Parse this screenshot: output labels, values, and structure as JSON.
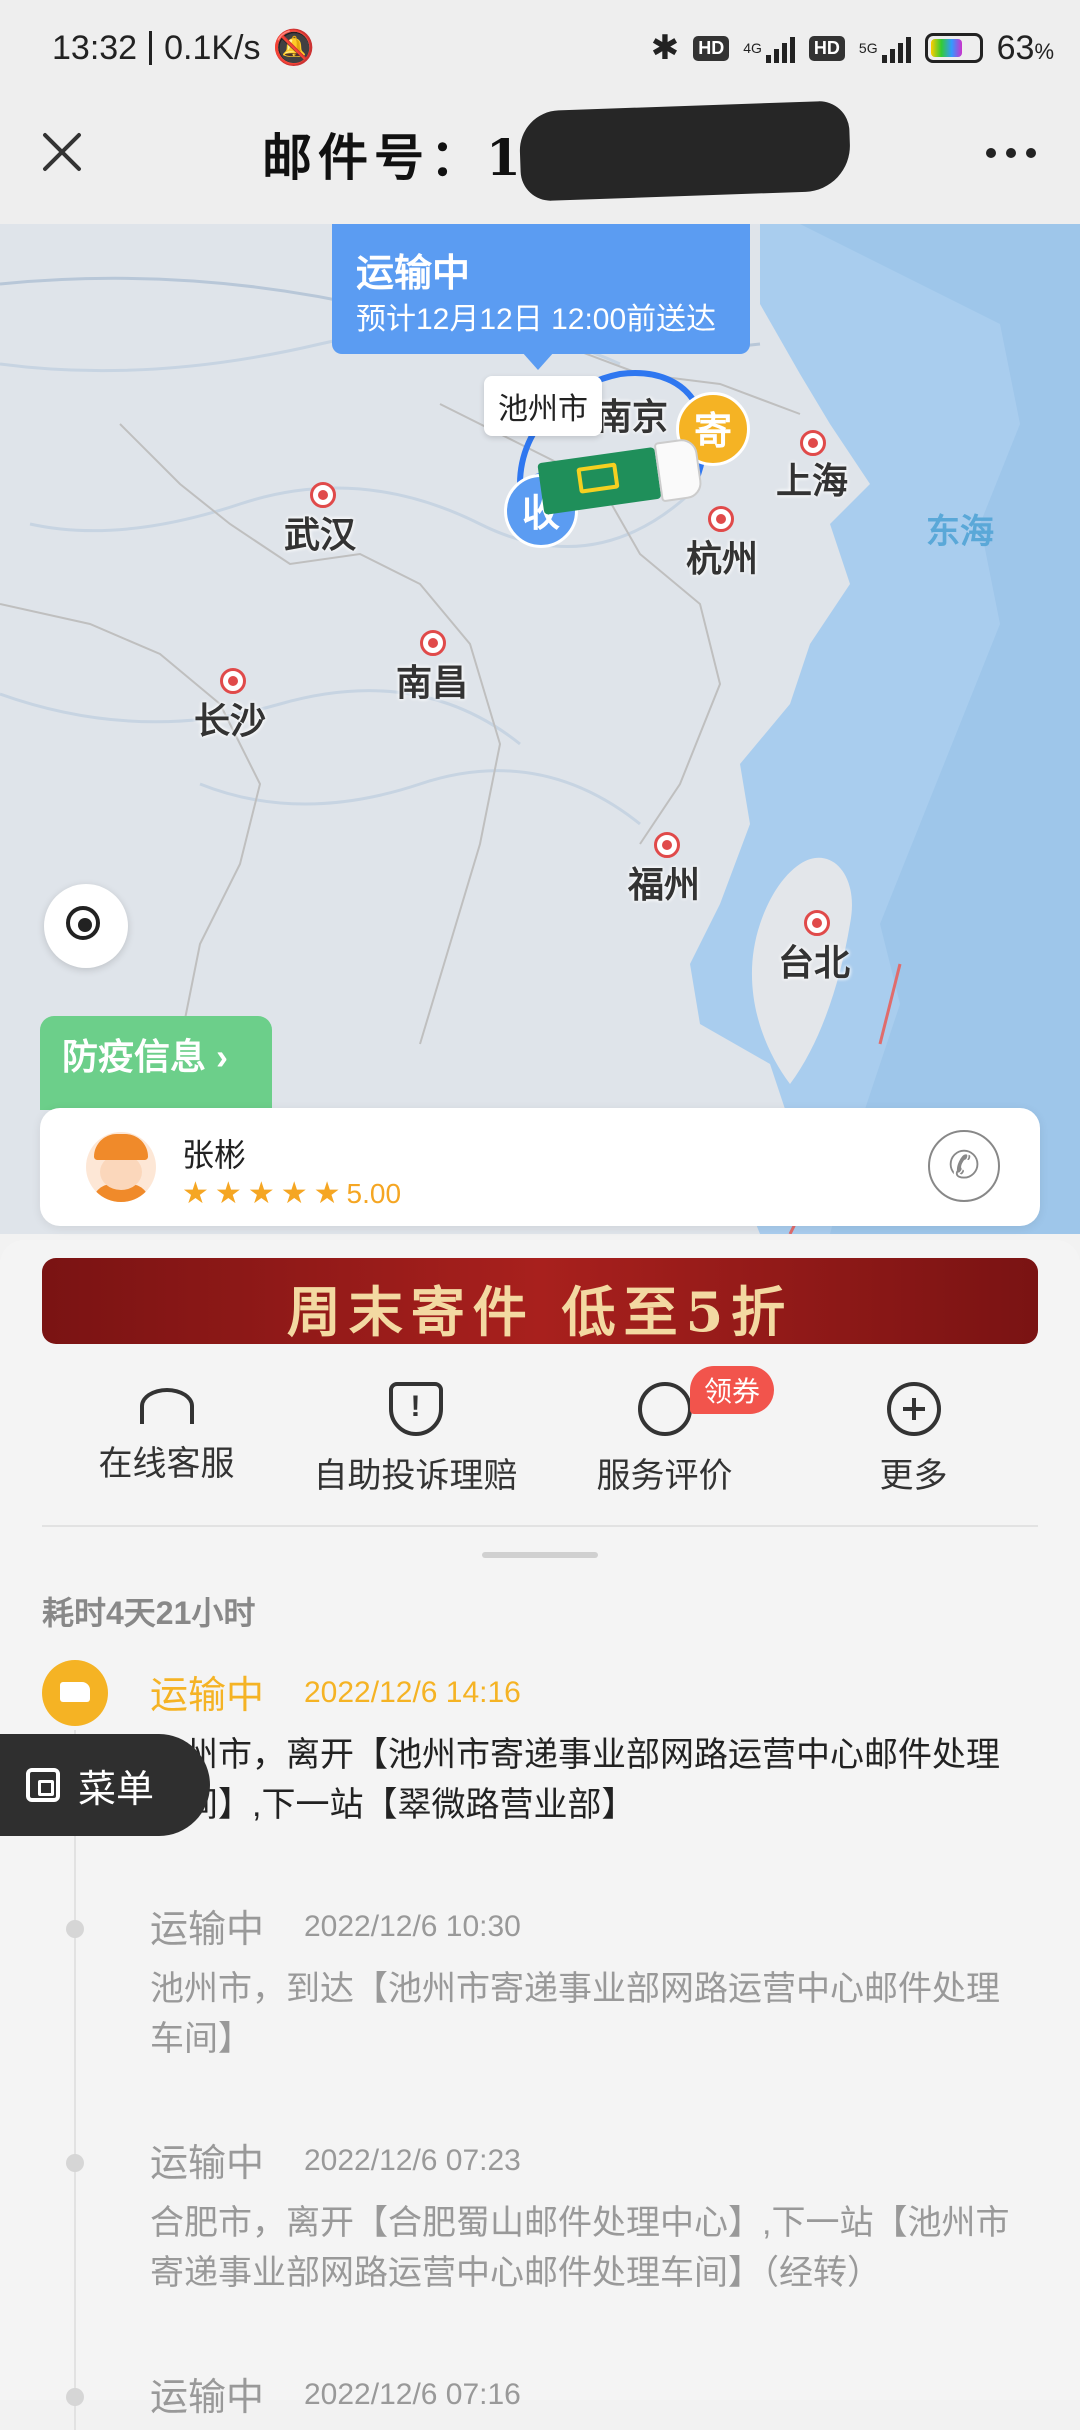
{
  "status_bar": {
    "time": "13:32",
    "net_speed": "0.1K/s",
    "battery": "63",
    "battery_unit": "%",
    "hd1": "HD",
    "hd2": "HD",
    "net1": "4G",
    "net2": "5G"
  },
  "header": {
    "title": "邮件号：12"
  },
  "map": {
    "status": "运输中",
    "eta": "预计12月12日 12:00前送达",
    "current_location": "池州市",
    "send_badge": "寄",
    "receive_badge": "收",
    "sea": "东海",
    "cities": [
      "南京",
      "上海",
      "杭州",
      "武汉",
      "南昌",
      "长沙",
      "福州",
      "台北"
    ]
  },
  "epidemic_button": "防疫信息 ›",
  "courier": {
    "name": "张彬",
    "rating": "5.00",
    "stars": 5
  },
  "banner": {
    "text": "周末寄件 低至5折"
  },
  "services": [
    {
      "label": "在线客服",
      "icon": "headset-icon"
    },
    {
      "label": "自助投诉理赔",
      "icon": "shield-alert-icon"
    },
    {
      "label": "服务评价",
      "icon": "rating-icon",
      "badge": "领券"
    },
    {
      "label": "更多",
      "icon": "plus-circle-icon"
    }
  ],
  "duration": "耗时4天21小时",
  "timeline": [
    {
      "status": "运输中",
      "time": "2022/12/6 14:16",
      "desc": "池州市，离开【池州市寄递事业部网路运营中心邮件处理车间】,下一站【翠微路营业部】"
    },
    {
      "status": "运输中",
      "time": "2022/12/6 10:30",
      "desc": "池州市，到达【池州市寄递事业部网路运营中心邮件处理车间】"
    },
    {
      "status": "运输中",
      "time": "2022/12/6 07:23",
      "desc": "合肥市，离开【合肥蜀山邮件处理中心】,下一站【池州市寄递事业部网路运营中心邮件处理车间】（经转）"
    },
    {
      "status": "运输中",
      "time": "2022/12/6 07:16",
      "desc": ""
    }
  ],
  "menu_button": "菜单",
  "colors": {
    "accent_yellow": "#f5b324",
    "map_blue": "#5b9cf2",
    "epidemic_green": "#6ccf8a",
    "coupon_red": "#f2544c"
  }
}
